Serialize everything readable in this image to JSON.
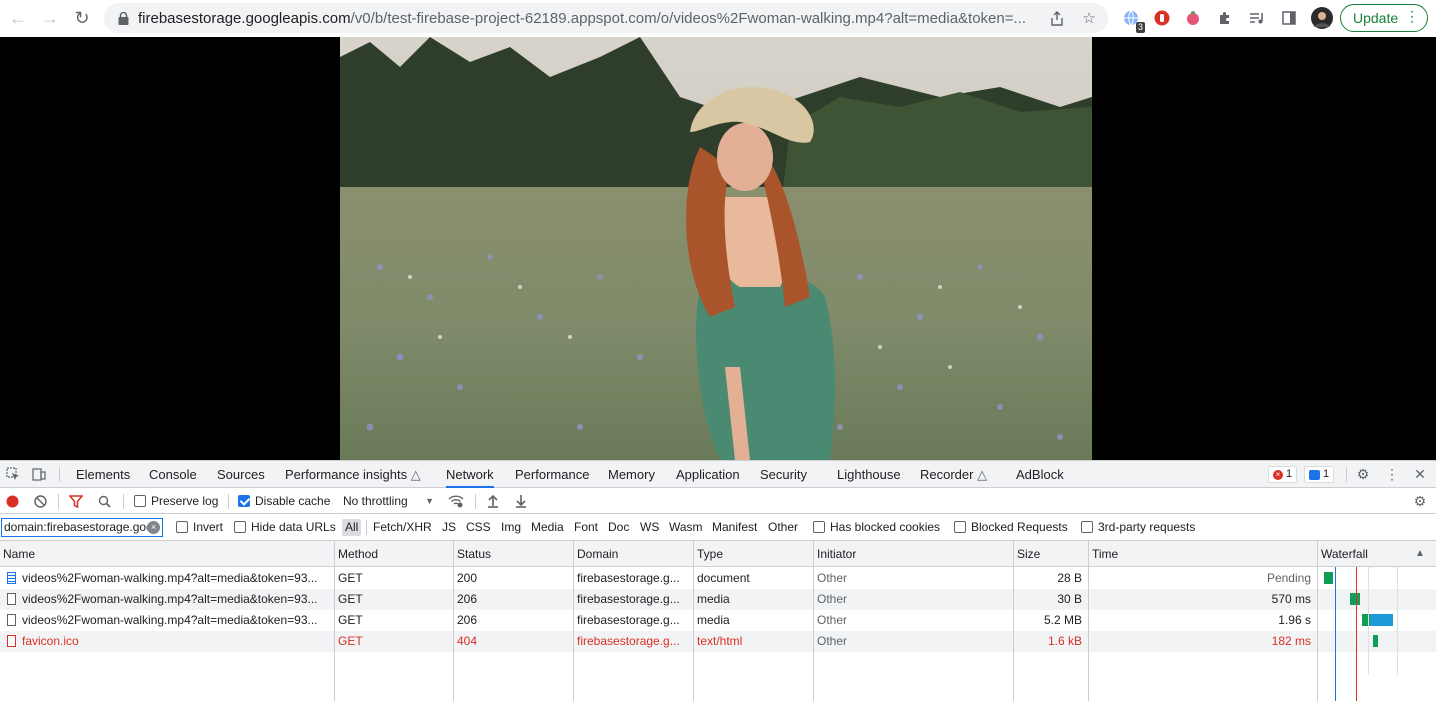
{
  "browser": {
    "url_host": "firebasestorage.googleapis.com",
    "url_path": "/v0/b/test-firebase-project-62189.appspot.com/o/videos%2Fwoman-walking.mp4?alt=media&token=...",
    "update_label": "Update",
    "extension_badge": "3"
  },
  "devtools": {
    "tabs": [
      "Elements",
      "Console",
      "Sources",
      "Performance insights",
      "Network",
      "Performance",
      "Memory",
      "Application",
      "Security",
      "Lighthouse",
      "Recorder",
      "AdBlock"
    ],
    "active_tab": "Network",
    "error_count": "1",
    "message_count": "1",
    "toolbar": {
      "preserve_log": "Preserve log",
      "disable_cache": "Disable cache",
      "throttling": "No throttling"
    },
    "filter": {
      "value": "domain:firebasestorage.goo",
      "invert": "Invert",
      "hide_data_urls": "Hide data URLs",
      "types": [
        "All",
        "Fetch/XHR",
        "JS",
        "CSS",
        "Img",
        "Media",
        "Font",
        "Doc",
        "WS",
        "Wasm",
        "Manifest",
        "Other"
      ],
      "has_blocked_cookies": "Has blocked cookies",
      "blocked_requests": "Blocked Requests",
      "third_party": "3rd-party requests"
    },
    "columns": [
      "Name",
      "Method",
      "Status",
      "Domain",
      "Type",
      "Initiator",
      "Size",
      "Time",
      "Waterfall"
    ],
    "rows": [
      {
        "name": "videos%2Fwoman-walking.mp4?alt=media&token=93...",
        "method": "GET",
        "status": "200",
        "domain": "firebasestorage.g...",
        "type": "document",
        "initiator": "Other",
        "size": "28 B",
        "time": "Pending"
      },
      {
        "name": "videos%2Fwoman-walking.mp4?alt=media&token=93...",
        "method": "GET",
        "status": "206",
        "domain": "firebasestorage.g...",
        "type": "media",
        "initiator": "Other",
        "size": "30 B",
        "time": "570 ms"
      },
      {
        "name": "videos%2Fwoman-walking.mp4?alt=media&token=93...",
        "method": "GET",
        "status": "206",
        "domain": "firebasestorage.g...",
        "type": "media",
        "initiator": "Other",
        "size": "5.2 MB",
        "time": "1.96 s"
      },
      {
        "name": "favicon.ico",
        "method": "GET",
        "status": "404",
        "domain": "firebasestorage.g...",
        "type": "text/html",
        "initiator": "Other",
        "size": "1.6 kB",
        "time": "182 ms"
      }
    ]
  },
  "colors": {
    "accent": "#1a73e8",
    "error": "#d93025",
    "green": "#188038"
  }
}
